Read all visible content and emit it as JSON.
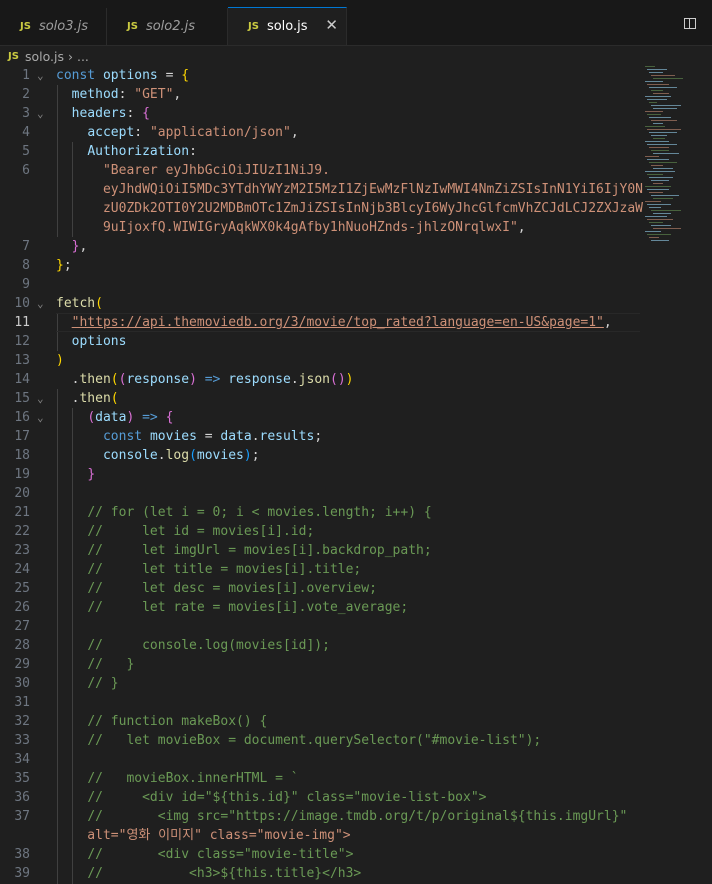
{
  "tabs": [
    {
      "icon": "JS",
      "label": "solo3.js",
      "active": false
    },
    {
      "icon": "JS",
      "label": "solo2.js",
      "active": false
    },
    {
      "icon": "JS",
      "label": "solo.js",
      "active": true
    }
  ],
  "tab_close": "✕",
  "breadcrumb": {
    "icon": "JS",
    "file": "solo.js",
    "sep": "›",
    "rest": "..."
  },
  "current_line": "11",
  "lines": [
    {
      "n": "1",
      "fold": "⌄",
      "t": "const options = {"
    },
    {
      "n": "2",
      "t": "  method: \"GET\","
    },
    {
      "n": "3",
      "fold": "⌄",
      "t": "  headers: {"
    },
    {
      "n": "4",
      "t": "    accept: \"application/json\","
    },
    {
      "n": "5",
      "t": "    Authorization:"
    },
    {
      "n": "6",
      "t": "      \"Bearer eyJhbGciOiJIUzI1NiJ9."
    },
    {
      "n": "",
      "t": "      eyJhdWQiOiI5MDc3YTdhYWYzM2I5MzI1ZjEwMzFlNzIwMWI4NmZiZSIsInN1YiI6IjY0N"
    },
    {
      "n": "",
      "t": "      zU0ZDk2OTI0Y2U2MDBmOTc1ZmJiZSIsInNjb3BlcyI6WyJhcGlfcmVhZCJdLCJ2ZXJzaW"
    },
    {
      "n": "",
      "t": "      9uIjoxfQ.WIWIGryAqkWX0k4gAfby1hNuoHZnds-jhlzONrqlwxI\","
    },
    {
      "n": "7",
      "t": "  },"
    },
    {
      "n": "8",
      "t": "};"
    },
    {
      "n": "9",
      "t": ""
    },
    {
      "n": "10",
      "fold": "⌄",
      "t": "fetch("
    },
    {
      "n": "11",
      "t": "  \"https://api.themoviedb.org/3/movie/top_rated?language=en-US&page=1\","
    },
    {
      "n": "12",
      "t": "  options"
    },
    {
      "n": "13",
      "t": ")"
    },
    {
      "n": "14",
      "t": "  .then((response) => response.json())"
    },
    {
      "n": "15",
      "fold": "⌄",
      "t": "  .then("
    },
    {
      "n": "16",
      "fold": "⌄",
      "t": "    (data) => {"
    },
    {
      "n": "17",
      "t": "      const movies = data.results;"
    },
    {
      "n": "18",
      "t": "      console.log(movies);"
    },
    {
      "n": "19",
      "t": "    }"
    },
    {
      "n": "20",
      "t": ""
    },
    {
      "n": "21",
      "t": "    // for (let i = 0; i < movies.length; i++) {"
    },
    {
      "n": "22",
      "t": "    //     let id = movies[i].id;"
    },
    {
      "n": "23",
      "t": "    //     let imgUrl = movies[i].backdrop_path;"
    },
    {
      "n": "24",
      "t": "    //     let title = movies[i].title;"
    },
    {
      "n": "25",
      "t": "    //     let desc = movies[i].overview;"
    },
    {
      "n": "26",
      "t": "    //     let rate = movies[i].vote_average;"
    },
    {
      "n": "27",
      "t": ""
    },
    {
      "n": "28",
      "t": "    //     console.log(movies[id]);"
    },
    {
      "n": "29",
      "t": "    //   }"
    },
    {
      "n": "30",
      "t": "    // }"
    },
    {
      "n": "31",
      "t": ""
    },
    {
      "n": "32",
      "t": "    // function makeBox() {"
    },
    {
      "n": "33",
      "t": "    //   let movieBox = document.querySelector(\"#movie-list\");"
    },
    {
      "n": "34",
      "t": ""
    },
    {
      "n": "35",
      "t": "    //   movieBox.innerHTML = `"
    },
    {
      "n": "36",
      "t": "    //     <div id=\"${this.id}\" class=\"movie-list-box\">"
    },
    {
      "n": "37",
      "t": "    //       <img src=\"https://image.tmdb.org/t/p/original${this.imgUrl}\""
    },
    {
      "n": "",
      "t": "    alt=\"영화 이미지\" class=\"movie-img\">"
    },
    {
      "n": "38",
      "t": "    //       <div class=\"movie-title\">"
    },
    {
      "n": "39",
      "t": "    //           <h3>${this.title}</h3>"
    }
  ]
}
